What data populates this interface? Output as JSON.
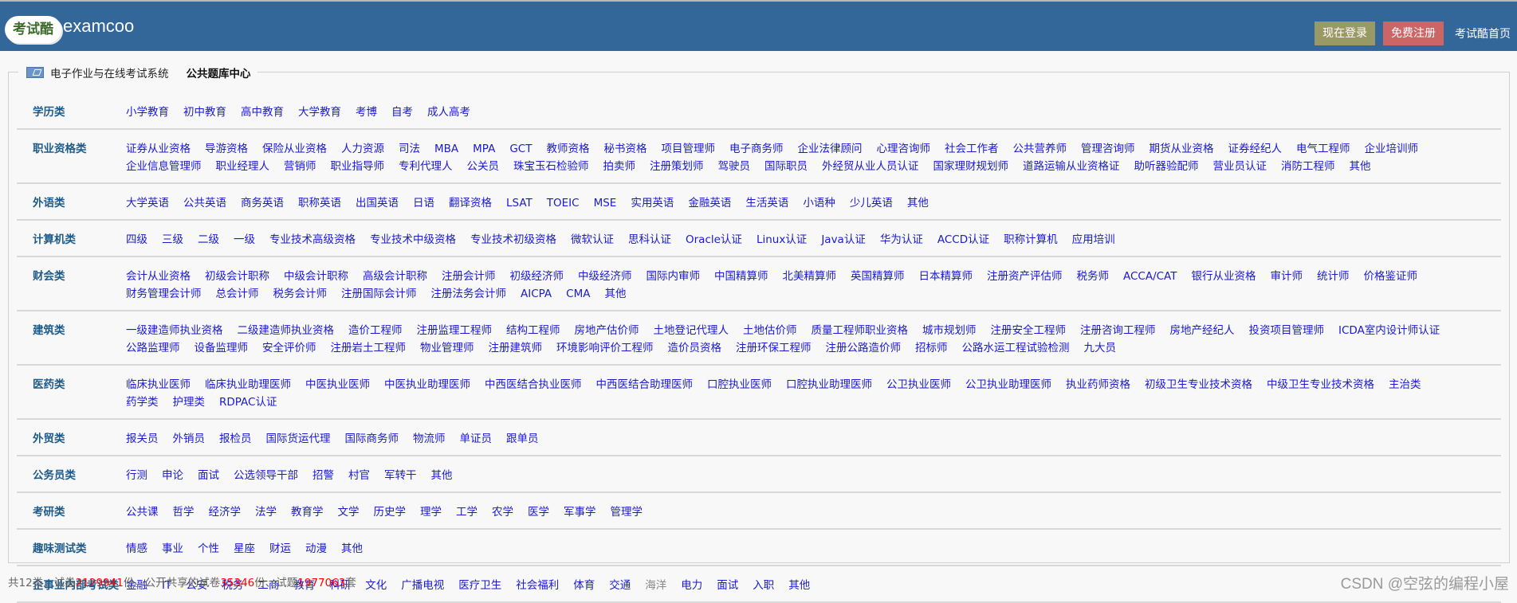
{
  "header": {
    "logo_text": "考试酷",
    "brand": "examcoo",
    "login_button": "现在登录",
    "register_button": "免费注册",
    "home_link": "考试酷首页",
    "colors": {
      "header_bg": "#336699",
      "login_bg": "#999966",
      "register_bg": "#cc6666"
    }
  },
  "panel": {
    "system_title": "电子作业与在线考试系统",
    "center_title": "公共题库中心"
  },
  "categories": [
    {
      "label": "学历类",
      "items": [
        "小学教育",
        "初中教育",
        "高中教育",
        "大学教育",
        "考博",
        "自考",
        "成人高考"
      ]
    },
    {
      "label": "职业资格类",
      "items": [
        "证券从业资格",
        "导游资格",
        "保险从业资格",
        "人力资源",
        "司法",
        "MBA",
        "MPA",
        "GCT",
        "教师资格",
        "秘书资格",
        "项目管理师",
        "电子商务师",
        "企业法律顾问",
        "心理咨询师",
        "社会工作者",
        "公共营养师",
        "管理咨询师",
        "期货从业资格",
        "证券经纪人",
        "电气工程师",
        "企业培训师",
        "企业信息管理师",
        "职业经理人",
        "营销师",
        "职业指导师",
        "专利代理人",
        "公关员",
        "珠宝玉石检验师",
        "拍卖师",
        "注册策划师",
        "驾驶员",
        "国际职员",
        "外经贸从业人员认证",
        "国家理财规划师",
        "道路运输从业资格证",
        "助听器验配师",
        "营业员认证",
        "消防工程师",
        "其他"
      ]
    },
    {
      "label": "外语类",
      "items": [
        "大学英语",
        "公共英语",
        "商务英语",
        "职称英语",
        "出国英语",
        "日语",
        "翻译资格",
        "LSAT",
        "TOEIC",
        "MSE",
        "实用英语",
        "金融英语",
        "生活英语",
        "小语种",
        "少儿英语",
        "其他"
      ]
    },
    {
      "label": "计算机类",
      "items": [
        "四级",
        "三级",
        "二级",
        "一级",
        "专业技术高级资格",
        "专业技术中级资格",
        "专业技术初级资格",
        "微软认证",
        "思科认证",
        "Oracle认证",
        "Linux认证",
        "Java认证",
        "华为认证",
        "ACCD认证",
        "职称计算机",
        "应用培训"
      ]
    },
    {
      "label": "财会类",
      "items": [
        "会计从业资格",
        "初级会计职称",
        "中级会计职称",
        "高级会计职称",
        "注册会计师",
        "初级经济师",
        "中级经济师",
        "国际内审师",
        "中国精算师",
        "北美精算师",
        "英国精算师",
        "日本精算师",
        "注册资产评估师",
        "税务师",
        "ACCA/CAT",
        "银行从业资格",
        "审计师",
        "统计师",
        "价格鉴证师",
        "财务管理会计师",
        "总会计师",
        "税务会计师",
        "注册国际会计师",
        "注册法务会计师",
        "AICPA",
        "CMA",
        "其他"
      ]
    },
    {
      "label": "建筑类",
      "items": [
        "一级建造师执业资格",
        "二级建造师执业资格",
        "造价工程师",
        "注册监理工程师",
        "结构工程师",
        "房地产估价师",
        "土地登记代理人",
        "土地估价师",
        "质量工程师职业资格",
        "城市规划师",
        "注册安全工程师",
        "注册咨询工程师",
        "房地产经纪人",
        "投资项目管理师",
        "ICDA室内设计师认证",
        "公路监理师",
        "设备监理师",
        "安全评价师",
        "注册岩土工程师",
        "物业管理师",
        "注册建筑师",
        "环境影响评价工程师",
        "造价员资格",
        "注册环保工程师",
        "注册公路造价师",
        "招标师",
        "公路水运工程试验检测",
        "九大员"
      ]
    },
    {
      "label": "医药类",
      "items": [
        "临床执业医师",
        "临床执业助理医师",
        "中医执业医师",
        "中医执业助理医师",
        "中西医结合执业医师",
        "中西医结合助理医师",
        "口腔执业医师",
        "口腔执业助理医师",
        "公卫执业医师",
        "公卫执业助理医师",
        "执业药师资格",
        "初级卫生专业技术资格",
        "中级卫生专业技术资格",
        "主治类",
        "药学类",
        "护理类",
        "RDPAC认证"
      ]
    },
    {
      "label": "外贸类",
      "items": [
        "报关员",
        "外销员",
        "报检员",
        "国际货运代理",
        "国际商务师",
        "物流师",
        "单证员",
        "跟单员"
      ]
    },
    {
      "label": "公务员类",
      "items": [
        "行测",
        "申论",
        "面试",
        "公选领导干部",
        "招警",
        "村官",
        "军转干",
        "其他"
      ]
    },
    {
      "label": "考研类",
      "items": [
        "公共课",
        "哲学",
        "经济学",
        "法学",
        "教育学",
        "文学",
        "历史学",
        "理学",
        "工学",
        "农学",
        "医学",
        "军事学",
        "管理学"
      ]
    },
    {
      "label": "趣味测试类",
      "items": [
        "情感",
        "事业",
        "个性",
        "星座",
        "财运",
        "动漫",
        "其他"
      ]
    },
    {
      "label": "企事业内部考试类",
      "items": [
        "金融",
        "IT",
        "公安",
        "税务",
        "工商",
        "教育",
        "科研",
        "文化",
        "广播电视",
        "医疗卫生",
        "社会福利",
        "体育",
        "交通",
        "海洋",
        "电力",
        "面试",
        "入职",
        "其他"
      ],
      "plain_items": [
        "海洋"
      ]
    }
  ],
  "footer": {
    "prefix": "共12类，试卷",
    "papers": "2129941",
    "mid1": "份。公开共享的试卷",
    "shared_papers": "35346",
    "mid2": "份、试题",
    "questions": "1977063",
    "suffix": "套"
  },
  "watermark": "CSDN @空弦的编程小屋"
}
